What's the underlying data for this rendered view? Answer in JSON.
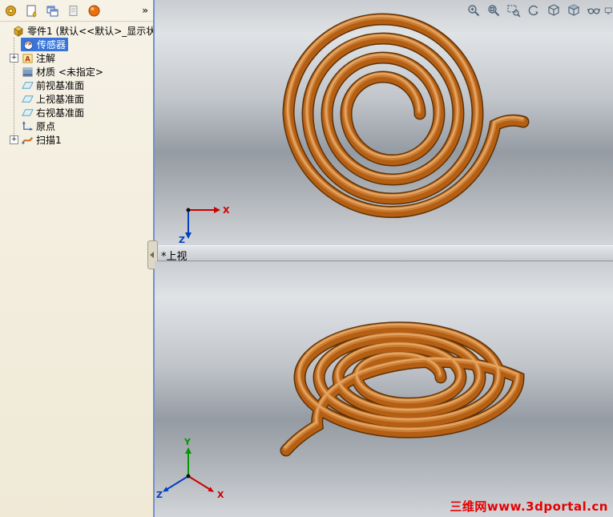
{
  "panel_toolbar": {
    "overflow_label": "»",
    "icons": [
      "tool-icon",
      "new-document-icon",
      "window-tile-icon",
      "document-icon",
      "help-sphere-icon"
    ]
  },
  "feature_tree": {
    "root_label": "零件1 (默认<<默认>_显示状态",
    "expand_glyph": "+",
    "annotation_icon_letter": "A",
    "items": [
      {
        "label": "传感器",
        "selected": true
      },
      {
        "label": "注解",
        "expandable": true
      },
      {
        "label": "材质 <未指定>"
      },
      {
        "label": "前视基准面"
      },
      {
        "label": "上视基准面"
      },
      {
        "label": "右视基准面"
      },
      {
        "label": "原点"
      },
      {
        "label": "扫描1",
        "expandable": true
      }
    ]
  },
  "view_toolbar": {
    "icons": [
      "zoom-in-out",
      "zoom-fit",
      "zoom-area",
      "rotate-view",
      "view-orientation",
      "display-style",
      "view-settings",
      "monitor-clipped"
    ]
  },
  "viewport": {
    "top_view_label": "*上视",
    "watermark": "三维网www.3dportal.cn",
    "triad_top": {
      "x": "X",
      "z": "Z"
    },
    "triad_bottom": {
      "x": "X",
      "y": "Y",
      "z": "Z"
    }
  },
  "colors": {
    "copper": "#b45f14",
    "copper_dark": "#5e3206",
    "copper_light": "#cf843a",
    "selection_blue": "#3875d7",
    "watermark_red": "#e60000"
  }
}
